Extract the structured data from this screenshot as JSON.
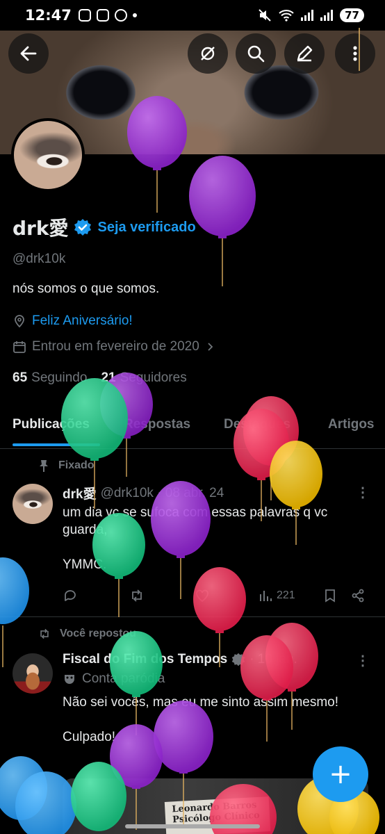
{
  "status_bar": {
    "time": "12:47",
    "battery": "77"
  },
  "profile": {
    "name": "drk愛",
    "verify_cta": "Seja verificado",
    "handle": "@drk10k",
    "bio": "nós somos o que somos.",
    "birthday_link": "Feliz Aniversário!",
    "joined": "Entrou em fevereiro de 2020",
    "following_count": "65",
    "following_label": "Seguindo",
    "followers_count": "21",
    "followers_label": "Seguidores"
  },
  "tabs": [
    {
      "label": "Publicações",
      "active": true
    },
    {
      "label": "Respostas",
      "active": false
    },
    {
      "label": "Destaques",
      "active": false
    },
    {
      "label": "Artigos",
      "active": false
    }
  ],
  "posts": [
    {
      "context": "Fixado",
      "author": "drk愛",
      "meta": "@drk10k · 08 abr. 24",
      "text": "um dia vc se sufoca com essas palavras q vc guarda,\n\nYMMC.",
      "views": "221"
    },
    {
      "context": "Você repostou",
      "author": "Fiscal do Fim dos Tempos",
      "meta": "· 10 jan.",
      "label": "Conta paródia",
      "text": "Não sei vocês, mas eu me sinto assim mesmo!\n\nCulpado!",
      "media_text": "Leonardo Barros\nPsicólogo Clínico"
    }
  ],
  "colors": {
    "accent": "#1d9bf0",
    "background": "#000000",
    "secondary_text": "#71767b"
  }
}
